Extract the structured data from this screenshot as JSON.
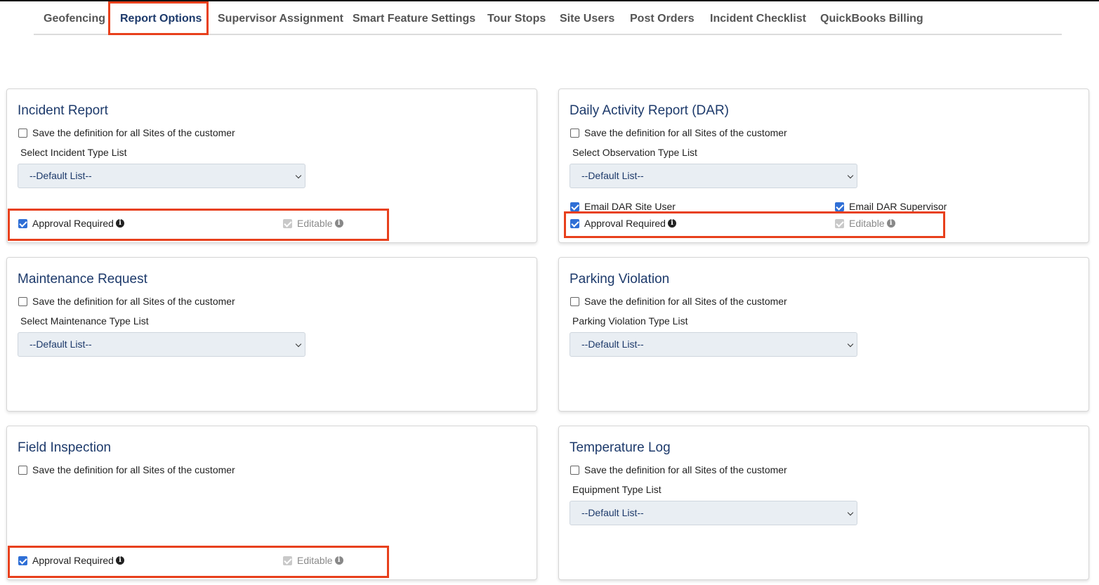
{
  "tabs": [
    {
      "label": "Geofencing",
      "active": false
    },
    {
      "label": "Report Options",
      "active": true
    },
    {
      "label": "Supervisor Assignment",
      "active": false
    },
    {
      "label": "Smart Feature Settings",
      "active": false
    },
    {
      "label": "Tour Stops",
      "active": false
    },
    {
      "label": "Site Users",
      "active": false
    },
    {
      "label": "Post Orders",
      "active": false
    },
    {
      "label": "Incident Checklist",
      "active": false
    },
    {
      "label": "QuickBooks Billing",
      "active": false
    }
  ],
  "common": {
    "save_all_label": "Save the definition for all Sites of the customer",
    "default_list": "--Default List--",
    "approval_label": "Approval Required",
    "editable_label": "Editable"
  },
  "cards": {
    "incident": {
      "title": "Incident Report",
      "select_label": "Select Incident Type List",
      "approval_checked": true
    },
    "dar": {
      "title": "Daily Activity Report (DAR)",
      "select_label": "Select Observation Type List",
      "email_site_user": "Email DAR Site User",
      "email_supervisor": "Email DAR Supervisor",
      "approval_checked": true
    },
    "maintenance": {
      "title": "Maintenance Request",
      "select_label": "Select Maintenance Type List"
    },
    "parking": {
      "title": "Parking Violation",
      "select_label": "Parking Violation Type List"
    },
    "field": {
      "title": "Field Inspection",
      "approval_checked": true
    },
    "temperature": {
      "title": "Temperature Log",
      "select_label": "Equipment Type List"
    }
  },
  "colors": {
    "accent": "#1d3a6b",
    "highlight": "#e8401c",
    "checkbox": "#2f6fd6"
  }
}
